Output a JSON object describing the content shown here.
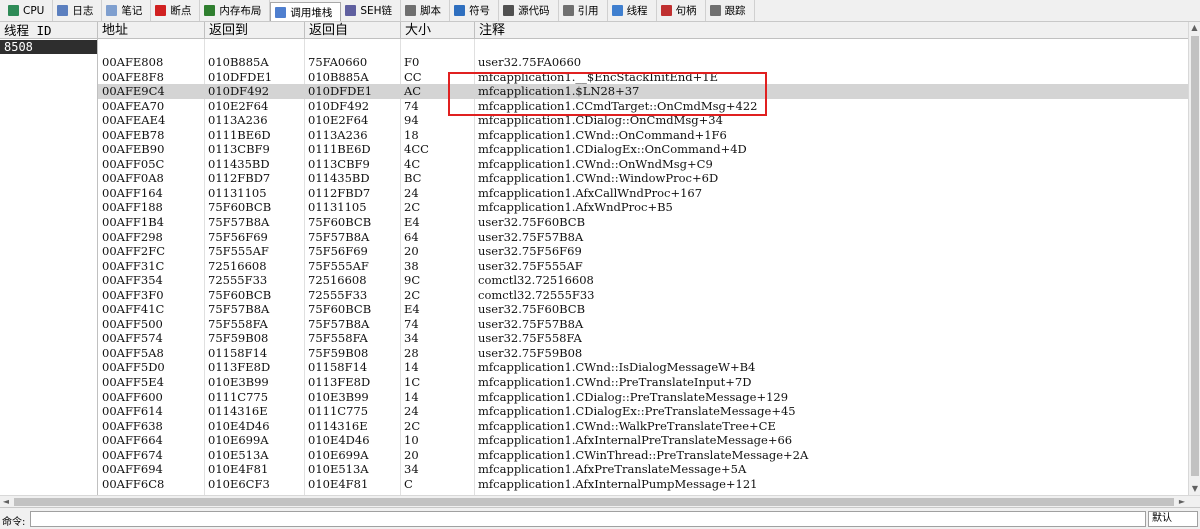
{
  "tabs": [
    {
      "label": "CPU",
      "icon": "cpu-icon",
      "color": "#2e8b57"
    },
    {
      "label": "日志",
      "icon": "log-icon",
      "color": "#5b7fbf"
    },
    {
      "label": "笔记",
      "icon": "notes-icon",
      "color": "#7f9fcf"
    },
    {
      "label": "断点",
      "icon": "breakpoint-icon",
      "color": "#d02020"
    },
    {
      "label": "内存布局",
      "icon": "memory-map-icon",
      "color": "#2f7f2f"
    },
    {
      "label": "调用堆栈",
      "icon": "call-stack-icon",
      "color": "#4f7fcf",
      "active": true
    },
    {
      "label": "SEH链",
      "icon": "seh-chain-icon",
      "color": "#5f5f9f"
    },
    {
      "label": "脚本",
      "icon": "script-icon",
      "color": "#6f6f6f"
    },
    {
      "label": "符号",
      "icon": "symbols-icon",
      "color": "#2f6fbf"
    },
    {
      "label": "源代码",
      "icon": "source-icon",
      "color": "#505050"
    },
    {
      "label": "引用",
      "icon": "references-icon",
      "color": "#707070"
    },
    {
      "label": "线程",
      "icon": "threads-icon",
      "color": "#3f7fcf"
    },
    {
      "label": "句柄",
      "icon": "handles-icon",
      "color": "#c03030"
    },
    {
      "label": "跟踪",
      "icon": "trace-icon",
      "color": "#6f6f6f"
    }
  ],
  "thread_panel": {
    "header": "线程 ID",
    "thread_id": "8508"
  },
  "columns": [
    "地址",
    "返回到",
    "返回自",
    "大小",
    "注释"
  ],
  "selected_row": 2,
  "rows": [
    [
      "00AFE808",
      "010B885A",
      "75FA0660",
      "F0",
      "user32.75FA0660"
    ],
    [
      "00AFE8F8",
      "010DFDE1",
      "010B885A",
      "CC",
      "mfcapplication1.__$EncStackInitEnd+1E"
    ],
    [
      "00AFE9C4",
      "010DF492",
      "010DFDE1",
      "AC",
      "mfcapplication1.$LN28+37"
    ],
    [
      "00AFEA70",
      "010E2F64",
      "010DF492",
      "74",
      "mfcapplication1.CCmdTarget::OnCmdMsg+422"
    ],
    [
      "00AFEAE4",
      "0113A236",
      "010E2F64",
      "94",
      "mfcapplication1.CDialog::OnCmdMsg+34"
    ],
    [
      "00AFEB78",
      "0111BE6D",
      "0113A236",
      "18",
      "mfcapplication1.CWnd::OnCommand+1F6"
    ],
    [
      "00AFEB90",
      "0113CBF9",
      "0111BE6D",
      "4CC",
      "mfcapplication1.CDialogEx::OnCommand+4D"
    ],
    [
      "00AFF05C",
      "011435BD",
      "0113CBF9",
      "4C",
      "mfcapplication1.CWnd::OnWndMsg+C9"
    ],
    [
      "00AFF0A8",
      "0112FBD7",
      "011435BD",
      "BC",
      "mfcapplication1.CWnd::WindowProc+6D"
    ],
    [
      "00AFF164",
      "01131105",
      "0112FBD7",
      "24",
      "mfcapplication1.AfxCallWndProc+167"
    ],
    [
      "00AFF188",
      "75F60BCB",
      "01131105",
      "2C",
      "mfcapplication1.AfxWndProc+B5"
    ],
    [
      "00AFF1B4",
      "75F57B8A",
      "75F60BCB",
      "E4",
      "user32.75F60BCB"
    ],
    [
      "00AFF298",
      "75F56F69",
      "75F57B8A",
      "64",
      "user32.75F57B8A"
    ],
    [
      "00AFF2FC",
      "75F555AF",
      "75F56F69",
      "20",
      "user32.75F56F69"
    ],
    [
      "00AFF31C",
      "72516608",
      "75F555AF",
      "38",
      "user32.75F555AF"
    ],
    [
      "00AFF354",
      "72555F33",
      "72516608",
      "9C",
      "comctl32.72516608"
    ],
    [
      "00AFF3F0",
      "75F60BCB",
      "72555F33",
      "2C",
      "comctl32.72555F33"
    ],
    [
      "00AFF41C",
      "75F57B8A",
      "75F60BCB",
      "E4",
      "user32.75F60BCB"
    ],
    [
      "00AFF500",
      "75F558FA",
      "75F57B8A",
      "74",
      "user32.75F57B8A"
    ],
    [
      "00AFF574",
      "75F59B08",
      "75F558FA",
      "34",
      "user32.75F558FA"
    ],
    [
      "00AFF5A8",
      "01158F14",
      "75F59B08",
      "28",
      "user32.75F59B08"
    ],
    [
      "00AFF5D0",
      "0113FE8D",
      "01158F14",
      "14",
      "mfcapplication1.CWnd::IsDialogMessageW+B4"
    ],
    [
      "00AFF5E4",
      "010E3B99",
      "0113FE8D",
      "1C",
      "mfcapplication1.CWnd::PreTranslateInput+7D"
    ],
    [
      "00AFF600",
      "0111C775",
      "010E3B99",
      "14",
      "mfcapplication1.CDialog::PreTranslateMessage+129"
    ],
    [
      "00AFF614",
      "0114316E",
      "0111C775",
      "24",
      "mfcapplication1.CDialogEx::PreTranslateMessage+45"
    ],
    [
      "00AFF638",
      "010E4D46",
      "0114316E",
      "2C",
      "mfcapplication1.CWnd::WalkPreTranslateTree+CE"
    ],
    [
      "00AFF664",
      "010E699A",
      "010E4D46",
      "10",
      "mfcapplication1.AfxInternalPreTranslateMessage+66"
    ],
    [
      "00AFF674",
      "010E513A",
      "010E699A",
      "20",
      "mfcapplication1.CWinThread::PreTranslateMessage+2A"
    ],
    [
      "00AFF694",
      "010E4F81",
      "010E513A",
      "34",
      "mfcapplication1.AfxPreTranslateMessage+5A"
    ],
    [
      "00AFF6C8",
      "010E6CF3",
      "010E4F81",
      "C",
      "mfcapplication1.AfxInternalPumpMessage+121"
    ]
  ],
  "scroll_arrows": {
    "up": "▲",
    "down": "▼",
    "left": "◄",
    "right": "►"
  },
  "command_bar": {
    "label": "命令:",
    "input_value": "",
    "mode": "默认"
  },
  "colors": {
    "highlight_box": "#e02020",
    "selected_row": "#d4d4d4",
    "thread_row": "#2e2e2e"
  }
}
